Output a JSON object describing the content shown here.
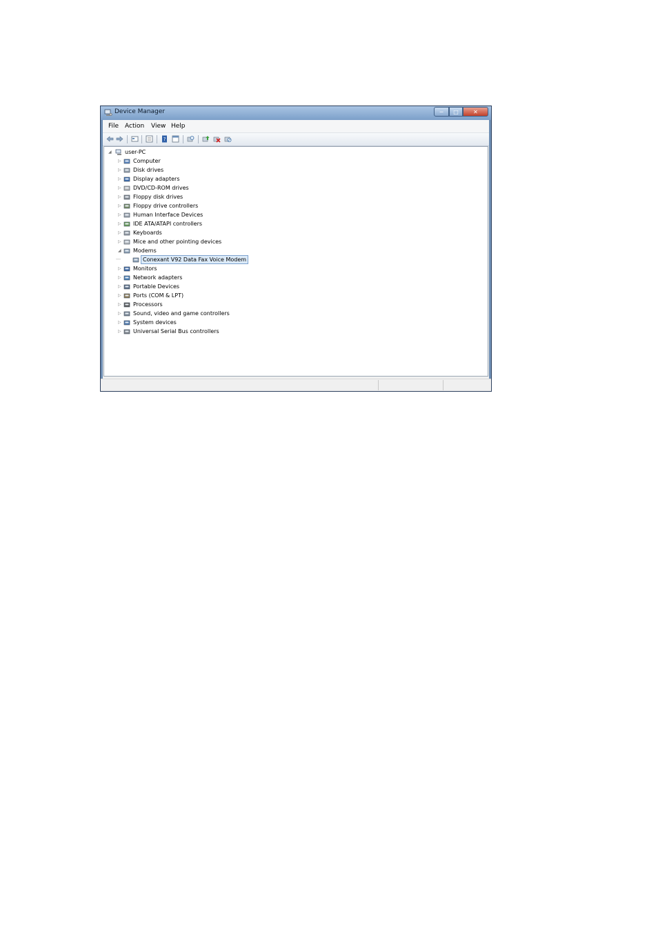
{
  "window": {
    "title": "Device Manager"
  },
  "menu": {
    "items": [
      "File",
      "Action",
      "View",
      "Help"
    ]
  },
  "toolbar": {
    "icons": [
      "back-icon",
      "forward-icon",
      "properties-sheet-icon",
      "show-hide-tree-icon",
      "help-icon",
      "view-icon",
      "scan-hardware-icon",
      "update-driver-icon",
      "uninstall-icon",
      "disable-icon"
    ]
  },
  "tree": {
    "root": "user-PC",
    "items": [
      {
        "label": "Computer",
        "icon": "computer-icon"
      },
      {
        "label": "Disk drives",
        "icon": "disk-drive-icon"
      },
      {
        "label": "Display adapters",
        "icon": "display-adapter-icon"
      },
      {
        "label": "DVD/CD-ROM drives",
        "icon": "dvd-drive-icon"
      },
      {
        "label": "Floppy disk drives",
        "icon": "floppy-drive-icon"
      },
      {
        "label": "Floppy drive controllers",
        "icon": "floppy-controller-icon"
      },
      {
        "label": "Human Interface Devices",
        "icon": "hid-icon"
      },
      {
        "label": "IDE ATA/ATAPI controllers",
        "icon": "ide-controller-icon"
      },
      {
        "label": "Keyboards",
        "icon": "keyboard-icon"
      },
      {
        "label": "Mice and other pointing devices",
        "icon": "mouse-icon"
      },
      {
        "label": "Modems",
        "icon": "modem-icon",
        "expanded": true
      },
      {
        "label": "Conexant V92 Data Fax Voice Modem",
        "icon": "modem-icon",
        "child": true,
        "selected": true
      },
      {
        "label": "Monitors",
        "icon": "monitor-icon"
      },
      {
        "label": "Network adapters",
        "icon": "network-adapter-icon"
      },
      {
        "label": "Portable Devices",
        "icon": "portable-device-icon"
      },
      {
        "label": "Ports (COM & LPT)",
        "icon": "port-icon"
      },
      {
        "label": "Processors",
        "icon": "processor-icon"
      },
      {
        "label": "Sound, video and game controllers",
        "icon": "sound-icon"
      },
      {
        "label": "System devices",
        "icon": "system-device-icon"
      },
      {
        "label": "Universal Serial Bus controllers",
        "icon": "usb-icon"
      }
    ]
  }
}
